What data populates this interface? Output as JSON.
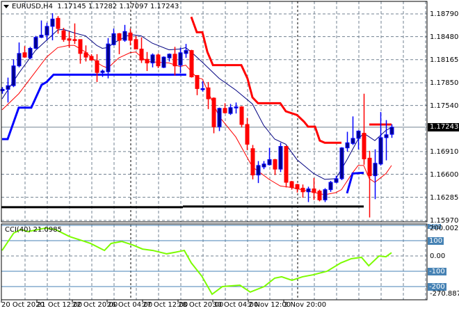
{
  "header": {
    "symbol": "EURUSD,H4",
    "open": "1.17145",
    "high": "1.17282",
    "low": "1.17097",
    "close": "1.17243"
  },
  "colors": {
    "bull_body": "#00008b",
    "bull_wick": "#0000ff",
    "bear": "#ff0000",
    "ma_fast": "#000080",
    "ma_slow": "#ff0000",
    "stop_up": "#0000ff",
    "stop_down": "#ff0000",
    "support": "#000000",
    "cci": "#7cfc00",
    "level": "#4682b4",
    "grid": "#708090"
  },
  "price_axis": {
    "labels": [
      "1.18790",
      "1.18480",
      "1.18165",
      "1.17850",
      "1.17540",
      "1.16910",
      "1.16600",
      "1.16285",
      "1.15970"
    ],
    "current": "1.17243"
  },
  "cci_axis": {
    "title": "CCI(40) 21.0985",
    "max": "200.0023",
    "l100": "100",
    "zero": "0.00",
    "lm100": "-100",
    "lm200": "-200",
    "min": "-270.8875",
    "l200": "200"
  },
  "time_axis": [
    "20 Oct 2020",
    "21 Oct 12:00",
    "22 Oct 20:00",
    "26 Oct 04:00",
    "27 Oct 12:00",
    "28 Oct 20:00",
    "30 Oct 04:00",
    "2 Nov 12:00",
    "3 Nov 20:00"
  ],
  "chart_data": {
    "type": "candlestick",
    "symbol": "EURUSD",
    "timeframe": "H4",
    "ylim": [
      1.1597,
      1.1898
    ],
    "price_gridlines": [
      1.1879,
      1.1848,
      1.18165,
      1.1785,
      1.1754,
      1.1691,
      1.166,
      1.16285,
      1.1597
    ],
    "current_price": 1.17243,
    "candles_ohlc": [
      [
        1.1774,
        1.1779,
        1.177,
        1.1776
      ],
      [
        1.1776,
        1.1792,
        1.1758,
        1.1781
      ],
      [
        1.1781,
        1.1817,
        1.1779,
        1.1808
      ],
      [
        1.1808,
        1.184,
        1.1806,
        1.1825
      ],
      [
        1.1826,
        1.1835,
        1.1819,
        1.182
      ],
      [
        1.1819,
        1.1834,
        1.1817,
        1.1832
      ],
      [
        1.1832,
        1.1849,
        1.1831,
        1.1847
      ],
      [
        1.1847,
        1.187,
        1.1846,
        1.185
      ],
      [
        1.185,
        1.1867,
        1.1843,
        1.1862
      ],
      [
        1.1862,
        1.188,
        1.1843,
        1.1872
      ],
      [
        1.1873,
        1.1876,
        1.1852,
        1.1859
      ],
      [
        1.1856,
        1.186,
        1.1841,
        1.1844
      ],
      [
        1.1845,
        1.1855,
        1.1833,
        1.1843
      ],
      [
        1.1844,
        1.1866,
        1.1838,
        1.1843
      ],
      [
        1.1844,
        1.1844,
        1.1811,
        1.1825
      ],
      [
        1.1826,
        1.1836,
        1.1814,
        1.182
      ],
      [
        1.1821,
        1.1824,
        1.1815,
        1.1816
      ],
      [
        1.1815,
        1.1824,
        1.1786,
        1.1799
      ],
      [
        1.1799,
        1.1803,
        1.1793,
        1.1801
      ],
      [
        1.18,
        1.1846,
        1.1791,
        1.1838
      ],
      [
        1.1837,
        1.1859,
        1.1836,
        1.1852
      ],
      [
        1.1852,
        1.1853,
        1.1824,
        1.1843
      ],
      [
        1.1843,
        1.1864,
        1.1841,
        1.1855
      ],
      [
        1.1853,
        1.1859,
        1.1836,
        1.1843
      ],
      [
        1.1844,
        1.1849,
        1.1831,
        1.1831
      ],
      [
        1.1831,
        1.1847,
        1.1812,
        1.1816
      ],
      [
        1.1817,
        1.1827,
        1.1801,
        1.1812
      ],
      [
        1.1812,
        1.1825,
        1.1806,
        1.1823
      ],
      [
        1.1823,
        1.1825,
        1.1805,
        1.1808
      ],
      [
        1.1806,
        1.1821,
        1.1805,
        1.182
      ],
      [
        1.1819,
        1.1825,
        1.1814,
        1.1824
      ],
      [
        1.1824,
        1.1834,
        1.1795,
        1.1808
      ],
      [
        1.1809,
        1.1833,
        1.1798,
        1.1826
      ],
      [
        1.1825,
        1.1838,
        1.1819,
        1.1829
      ],
      [
        1.1829,
        1.183,
        1.1792,
        1.1793
      ],
      [
        1.1795,
        1.1795,
        1.1768,
        1.1777
      ],
      [
        1.1777,
        1.1787,
        1.1773,
        1.1777
      ],
      [
        1.1778,
        1.1786,
        1.1749,
        1.1763
      ],
      [
        1.1764,
        1.1765,
        1.1716,
        1.1725
      ],
      [
        1.1725,
        1.1751,
        1.1719,
        1.175
      ],
      [
        1.175,
        1.1757,
        1.1743,
        1.1744
      ],
      [
        1.1743,
        1.1756,
        1.1741,
        1.1751
      ],
      [
        1.1751,
        1.1758,
        1.1743,
        1.1752
      ],
      [
        1.1752,
        1.1753,
        1.1724,
        1.1728
      ],
      [
        1.1728,
        1.1737,
        1.1693,
        1.1701
      ],
      [
        1.1695,
        1.17,
        1.1653,
        1.1659
      ],
      [
        1.1659,
        1.1678,
        1.1648,
        1.1672
      ],
      [
        1.167,
        1.1678,
        1.1667,
        1.1674
      ],
      [
        1.1673,
        1.1696,
        1.1672,
        1.168
      ],
      [
        1.168,
        1.1681,
        1.1659,
        1.1667
      ],
      [
        1.1667,
        1.1703,
        1.1663,
        1.1698
      ],
      [
        1.1698,
        1.1699,
        1.1642,
        1.1649
      ],
      [
        1.165,
        1.1651,
        1.1639,
        1.1642
      ],
      [
        1.1646,
        1.1647,
        1.1635,
        1.164
      ],
      [
        1.1641,
        1.1646,
        1.1628,
        1.1636
      ],
      [
        1.1636,
        1.1643,
        1.1622,
        1.164
      ],
      [
        1.164,
        1.1655,
        1.1625,
        1.1635
      ],
      [
        1.1637,
        1.1639,
        1.1623,
        1.1625
      ],
      [
        1.1625,
        1.1641,
        1.1622,
        1.1639
      ],
      [
        1.1639,
        1.1651,
        1.1636,
        1.1649
      ],
      [
        1.1649,
        1.1658,
        1.1648,
        1.1654
      ],
      [
        1.1654,
        1.1697,
        1.1652,
        1.1696
      ],
      [
        1.1696,
        1.1718,
        1.1691,
        1.1703
      ],
      [
        1.1702,
        1.1739,
        1.17,
        1.1709
      ],
      [
        1.1709,
        1.172,
        1.1694,
        1.1719
      ],
      [
        1.1716,
        1.177,
        1.1673,
        1.1681
      ],
      [
        1.1682,
        1.1692,
        1.1601,
        1.1658
      ],
      [
        1.1658,
        1.1694,
        1.1626,
        1.1675
      ],
      [
        1.1674,
        1.1745,
        1.1672,
        1.171
      ],
      [
        1.171,
        1.1734,
        1.1679,
        1.1714
      ],
      [
        1.17145,
        1.17282,
        1.17097,
        1.17243
      ]
    ],
    "ma_fast": [
      [
        0,
        1.1763
      ],
      [
        3,
        1.1798
      ],
      [
        6,
        1.1829
      ],
      [
        8,
        1.1843
      ],
      [
        10,
        1.1857
      ],
      [
        11,
        1.1858
      ],
      [
        13,
        1.1853
      ],
      [
        15,
        1.1849
      ],
      [
        17,
        1.1836
      ],
      [
        18,
        1.1832
      ],
      [
        19,
        1.1833
      ],
      [
        20,
        1.1839
      ],
      [
        23,
        1.1851
      ],
      [
        25,
        1.1849
      ],
      [
        27,
        1.1839
      ],
      [
        30,
        1.183
      ],
      [
        32,
        1.1831
      ],
      [
        33,
        1.1833
      ],
      [
        34,
        1.1827
      ],
      [
        36,
        1.1813
      ],
      [
        39,
        1.1791
      ],
      [
        42,
        1.1775
      ],
      [
        45,
        1.1756
      ],
      [
        47,
        1.1727
      ],
      [
        49,
        1.1708
      ],
      [
        51,
        1.1701
      ],
      [
        53,
        1.168
      ],
      [
        56,
        1.1661
      ],
      [
        58,
        1.1653
      ],
      [
        60,
        1.1654
      ],
      [
        62,
        1.168
      ],
      [
        64,
        1.1708
      ],
      [
        65,
        1.1716
      ],
      [
        67,
        1.1706
      ],
      [
        69,
        1.172
      ],
      [
        70,
        1.1724
      ]
    ],
    "ma_slow": [
      [
        0,
        1.1748
      ],
      [
        3,
        1.177
      ],
      [
        6,
        1.18
      ],
      [
        8,
        1.182
      ],
      [
        10,
        1.1833
      ],
      [
        12,
        1.1836
      ],
      [
        13,
        1.1836
      ],
      [
        15,
        1.1827
      ],
      [
        17,
        1.1813
      ],
      [
        18,
        1.1808
      ],
      [
        19,
        1.1805
      ],
      [
        21,
        1.1819
      ],
      [
        23,
        1.1826
      ],
      [
        24,
        1.1827
      ],
      [
        26,
        1.1814
      ],
      [
        28,
        1.1813
      ],
      [
        30,
        1.1812
      ],
      [
        32,
        1.1807
      ],
      [
        33,
        1.1809
      ],
      [
        35,
        1.1792
      ],
      [
        36,
        1.179
      ],
      [
        39,
        1.1739
      ],
      [
        42,
        1.1711
      ],
      [
        45,
        1.167
      ],
      [
        48,
        1.1653
      ],
      [
        50,
        1.1644
      ],
      [
        52,
        1.1642
      ],
      [
        55,
        1.1637
      ],
      [
        58,
        1.1632
      ],
      [
        60,
        1.1635
      ],
      [
        61,
        1.1639
      ],
      [
        63,
        1.1662
      ],
      [
        64,
        1.1672
      ],
      [
        65,
        1.1672
      ],
      [
        66,
        1.1654
      ],
      [
        67,
        1.1649
      ],
      [
        69,
        1.1661
      ],
      [
        70,
        1.1672
      ]
    ],
    "stop_up": [
      [
        [
          0,
          1.1708
        ],
        [
          1,
          1.1708
        ],
        [
          3,
          1.1751
        ],
        [
          5.25,
          1.1751
        ],
        [
          7.1,
          1.1782
        ],
        [
          8,
          1.1786
        ],
        [
          9.25,
          1.1796
        ],
        [
          33.1,
          1.1796
        ]
      ],
      [
        [
          62,
          1.1634
        ],
        [
          63,
          1.1661
        ],
        [
          65,
          1.1662
        ]
      ]
    ],
    "stop_down": [
      [
        [
          34,
          1.1875
        ],
        [
          35,
          1.1854
        ],
        [
          36,
          1.1854
        ],
        [
          36.9,
          1.1827
        ],
        [
          37.9,
          1.1809
        ],
        [
          43,
          1.1809
        ],
        [
          44.1,
          1.1791
        ],
        [
          45,
          1.1765
        ],
        [
          46,
          1.1757
        ],
        [
          50,
          1.1757
        ],
        [
          51,
          1.1746
        ],
        [
          53,
          1.1741
        ],
        [
          54.25,
          1.1732
        ],
        [
          55,
          1.1725
        ],
        [
          56.25,
          1.1725
        ],
        [
          57.1,
          1.1706
        ],
        [
          58,
          1.1703
        ],
        [
          61,
          1.1703
        ]
      ],
      [
        [
          66,
          1.1728
        ],
        [
          70,
          1.1728
        ]
      ]
    ],
    "support_line": [
      [
        [
          -0.1,
          1.1615
        ],
        [
          32.5,
          1.1615
        ]
      ],
      [
        [
          32.5,
          1.1616
        ],
        [
          65,
          1.1616
        ]
      ]
    ],
    "cci": {
      "period": 40,
      "value": 21.0985,
      "ylim": [
        -270.8875,
        200.0023
      ],
      "levels": [
        200,
        100,
        -100,
        -200
      ],
      "points": [
        [
          0,
          36
        ],
        [
          2.1,
          150
        ],
        [
          3.4,
          173
        ],
        [
          4.6,
          159
        ],
        [
          6.5,
          173
        ],
        [
          7.75,
          182
        ],
        [
          9.6,
          173
        ],
        [
          12.1,
          127
        ],
        [
          14,
          105
        ],
        [
          15.9,
          82
        ],
        [
          18.4,
          36
        ],
        [
          19.6,
          82
        ],
        [
          21.5,
          95
        ],
        [
          23.4,
          73
        ],
        [
          25.25,
          45
        ],
        [
          27.1,
          36
        ],
        [
          29.6,
          14
        ],
        [
          31.5,
          27
        ],
        [
          32.75,
          36
        ],
        [
          34,
          -45
        ],
        [
          35.9,
          -132
        ],
        [
          37.75,
          -250
        ],
        [
          39.6,
          -200
        ],
        [
          42.75,
          -191
        ],
        [
          44.6,
          -236
        ],
        [
          47.1,
          -200
        ],
        [
          49,
          -145
        ],
        [
          50.25,
          -136
        ],
        [
          52.1,
          -159
        ],
        [
          54,
          -136
        ],
        [
          55.9,
          -123
        ],
        [
          58.4,
          -100
        ],
        [
          60.9,
          -45
        ],
        [
          62.75,
          -18
        ],
        [
          64.6,
          -9
        ],
        [
          65.9,
          -64
        ],
        [
          67.75,
          0
        ],
        [
          69,
          -5
        ],
        [
          70,
          21.1
        ]
      ]
    }
  }
}
